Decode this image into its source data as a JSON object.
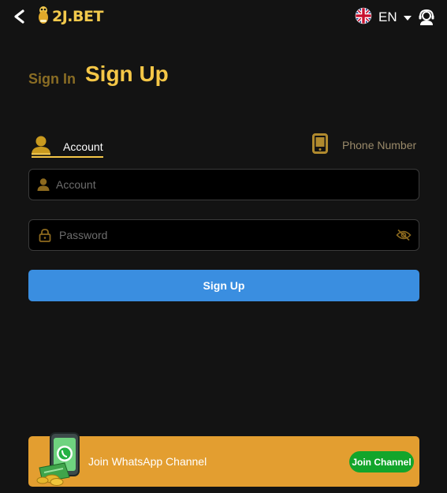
{
  "header": {
    "logo_text": "2J.BET",
    "language_label": "EN"
  },
  "auth": {
    "signin_label": "Sign In",
    "signup_label": "Sign Up"
  },
  "method_tabs": {
    "account_label": "Account",
    "phone_label": "Phone Number"
  },
  "form": {
    "account_placeholder": "Account",
    "password_placeholder": "Password",
    "submit_label": "Sign Up"
  },
  "banner": {
    "text": "Join WhatsApp Channel",
    "button_label": "Join Channel"
  },
  "colors": {
    "background": "#131313",
    "accent": "#f5c747",
    "button": "#3a8ee0",
    "banner": "#e39e30",
    "join_button": "#12a52b"
  },
  "icons": [
    "back-arrow-icon",
    "logo-mascot-icon",
    "uk-flag-icon",
    "caret-down-icon",
    "support-agent-icon",
    "user-icon",
    "phone-icon",
    "lock-icon",
    "eye-off-icon",
    "whatsapp-icon"
  ]
}
